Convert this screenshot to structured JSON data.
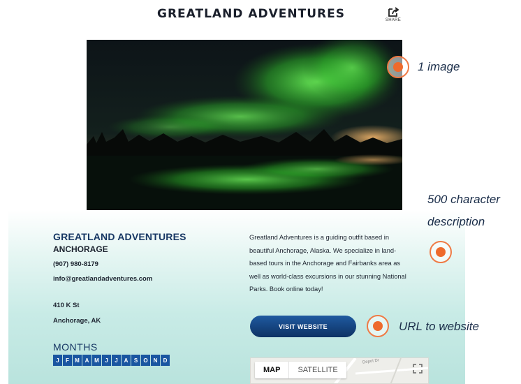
{
  "header": {
    "title": "GREATLAND ADVENTURES",
    "share_label": "SHARE"
  },
  "hero": {
    "alt": "Northern lights over a lake",
    "colors": {
      "sky": "#0b1419",
      "aurora": "#3ccf3a",
      "glow": "#e8a15a"
    }
  },
  "annotations": {
    "image": "1 image",
    "description_line1": "500 character",
    "description_line2": "description",
    "url": "URL to website",
    "accent_color": "#ee6a2c"
  },
  "business": {
    "name": "GREATLAND ADVENTURES",
    "city": "ANCHORAGE",
    "phone": "(907) 980-8179",
    "email": "info@greatlandadventures.com",
    "address_line1": "410 K St",
    "address_line2": "Anchorage, AK"
  },
  "months": {
    "title": "MONTHS",
    "letters": [
      "J",
      "F",
      "M",
      "A",
      "M",
      "J",
      "J",
      "A",
      "S",
      "O",
      "N",
      "D"
    ]
  },
  "description": {
    "lines": [
      "Greatland Adventures is a guiding outfit based in",
      "beautiful Anchorage, Alaska. We specialize in land-",
      "based tours in the Anchorage and Fairbanks area as",
      "well as world-class excursions in our stunning National",
      "Parks. Book online today!"
    ]
  },
  "actions": {
    "visit_website": "VISIT WEBSITE"
  },
  "map": {
    "tab_map": "MAP",
    "tab_satellite": "SATELLITE",
    "street": "Depot Dr"
  }
}
